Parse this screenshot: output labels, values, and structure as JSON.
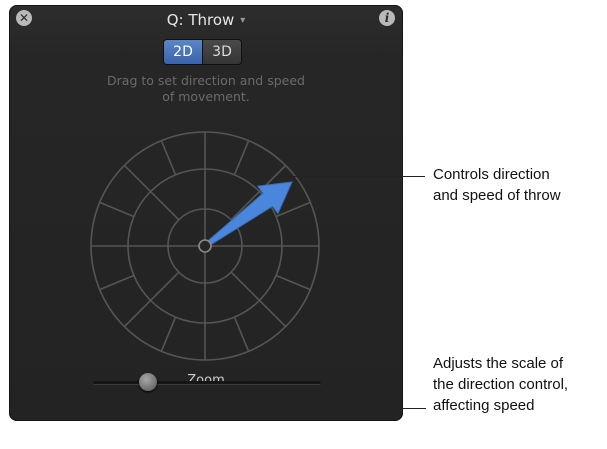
{
  "hud": {
    "title": "Q: Throw",
    "title_caret": "▾",
    "close_glyph": "✕",
    "info_glyph": "i",
    "mode_options": [
      "2D",
      "3D"
    ],
    "mode_selected": "2D",
    "instructions_line1": "Drag to set direction and speed",
    "instructions_line2": "of movement.",
    "zoom_label": "Zoom",
    "zoom_value_fraction": 0.24
  },
  "callouts": {
    "direction_line1": "Controls direction",
    "direction_line2": "and speed of throw",
    "zoom_line1": "Adjusts the scale of",
    "zoom_line2": "the direction control,",
    "zoom_line3": "affecting speed"
  },
  "colors": {
    "hud_bg": "#262626",
    "accent": "#4a78c4",
    "arrow": "#4a87dc",
    "grid": "#555555"
  },
  "icons": {
    "close": "close-icon",
    "info": "info-icon",
    "caret": "chevron-down-icon"
  }
}
